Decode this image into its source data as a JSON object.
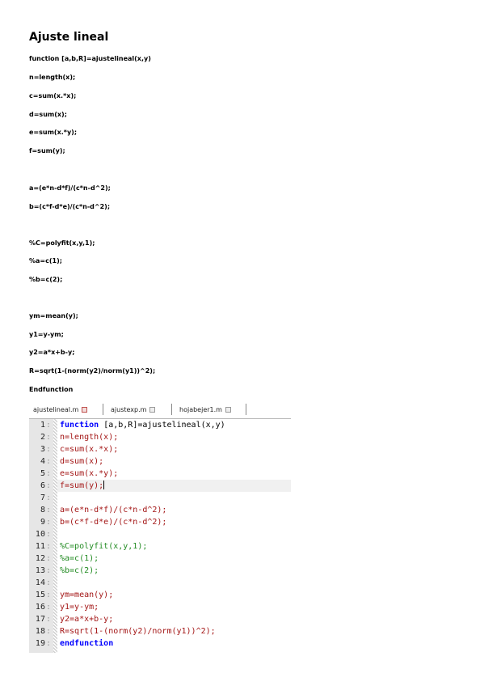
{
  "document": {
    "title": "Ajuste lineal",
    "lines": [
      "function [a,b,R]=ajustelineal(x,y)",
      "n=length(x);",
      "c=sum(x.*x);",
      "d=sum(x);",
      "e=sum(x.*y);",
      "f=sum(y);",
      "",
      "a=(e*n-d*f)/(c*n-d^2);",
      "b=(c*f-d*e)/(c*n-d^2);",
      "",
      "%C=polyfit(x,y,1);",
      "%a=c(1);",
      "%b=c(2);",
      "",
      "ym=mean(y);",
      "y1=y-ym;",
      "y2=a*x+b-y;",
      "R=sqrt(1-(norm(y2)/norm(y1))^2);",
      "Endfunction"
    ]
  },
  "editor": {
    "tabs": [
      {
        "label": "ajustelineal.m",
        "active": true
      },
      {
        "label": "ajustexp.m",
        "active": false
      },
      {
        "label": "hojabejer1.m",
        "active": false
      }
    ],
    "current_line": 6,
    "colors": {
      "keyword": "#0000ff",
      "code": "#a31515",
      "comment": "#228b22"
    },
    "code_lines": [
      {
        "num": "1",
        "segments": [
          {
            "text": "function",
            "kind": "keyword"
          },
          {
            "text": " [a,b,R]=ajustelineal(x,y)",
            "kind": "plain"
          }
        ]
      },
      {
        "num": "2",
        "segments": [
          {
            "text": "n=length(x);",
            "kind": "code"
          }
        ]
      },
      {
        "num": "3",
        "segments": [
          {
            "text": "c=sum(x.*x);",
            "kind": "code"
          }
        ]
      },
      {
        "num": "4",
        "segments": [
          {
            "text": "d=sum(x);",
            "kind": "code"
          }
        ]
      },
      {
        "num": "5",
        "segments": [
          {
            "text": "e=sum(x.*y);",
            "kind": "code"
          }
        ]
      },
      {
        "num": "6",
        "segments": [
          {
            "text": "f=sum(y);",
            "kind": "code"
          }
        ]
      },
      {
        "num": "7",
        "segments": []
      },
      {
        "num": "8",
        "segments": [
          {
            "text": "a=(e*n-d*f)/(c*n-d^2);",
            "kind": "code"
          }
        ]
      },
      {
        "num": "9",
        "segments": [
          {
            "text": "b=(c*f-d*e)/(c*n-d^2);",
            "kind": "code"
          }
        ]
      },
      {
        "num": "10",
        "segments": []
      },
      {
        "num": "11",
        "segments": [
          {
            "text": "%C=polyfit(x,y,1);",
            "kind": "comment"
          }
        ]
      },
      {
        "num": "12",
        "segments": [
          {
            "text": "%a=c(1);",
            "kind": "comment"
          }
        ]
      },
      {
        "num": "13",
        "segments": [
          {
            "text": "%b=c(2);",
            "kind": "comment"
          }
        ]
      },
      {
        "num": "14",
        "segments": []
      },
      {
        "num": "15",
        "segments": [
          {
            "text": "ym=mean(y);",
            "kind": "code"
          }
        ]
      },
      {
        "num": "16",
        "segments": [
          {
            "text": "y1=y-ym;",
            "kind": "code"
          }
        ]
      },
      {
        "num": "17",
        "segments": [
          {
            "text": "y2=a*x+b-y;",
            "kind": "code"
          }
        ]
      },
      {
        "num": "18",
        "segments": [
          {
            "text": "R=sqrt(1-(norm(y2)/norm(y1))^2);",
            "kind": "code"
          }
        ]
      },
      {
        "num": "19",
        "segments": [
          {
            "text": "endfunction",
            "kind": "keyword"
          }
        ]
      }
    ]
  }
}
